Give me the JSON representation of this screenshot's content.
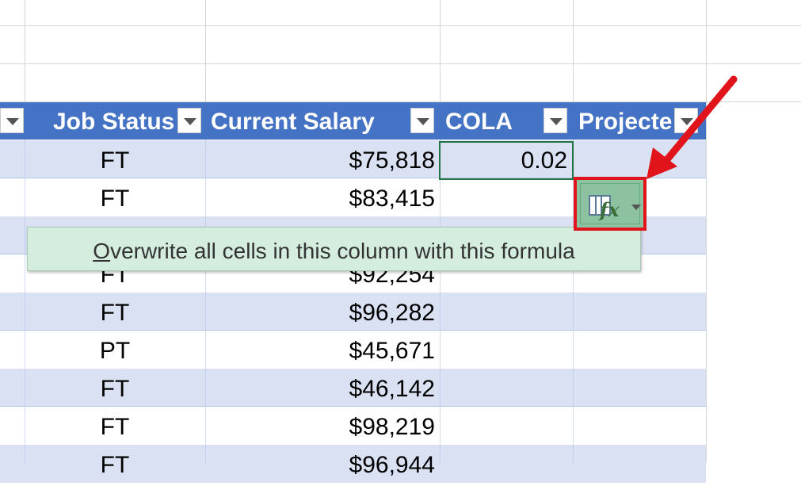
{
  "columns": {
    "job_status": "Job Status",
    "current_salary": "Current Salary",
    "cola": "COLA",
    "projected": "Projecte"
  },
  "rows": [
    {
      "status": "FT",
      "salary": "$75,818",
      "cola": "0.02"
    },
    {
      "status": "FT",
      "salary": "$83,415",
      "cola": ""
    },
    {
      "status": "",
      "salary": "",
      "cola": ""
    },
    {
      "status": "FT",
      "salary": "$92,254",
      "cola": ""
    },
    {
      "status": "FT",
      "salary": "$96,282",
      "cola": ""
    },
    {
      "status": "PT",
      "salary": "$45,671",
      "cola": ""
    },
    {
      "status": "FT",
      "salary": "$46,142",
      "cola": ""
    },
    {
      "status": "FT",
      "salary": "$98,219",
      "cola": ""
    },
    {
      "status": "FT",
      "salary": "$96,944",
      "cola": ""
    }
  ],
  "tooltip": {
    "accel": "O",
    "rest": "verwrite all cells in this column with this formula"
  },
  "smart_tag": {
    "icon": "autocorrect-options-icon"
  },
  "colors": {
    "header_bg": "#4472c4",
    "band_bg": "#d9e1f2",
    "tooltip_bg": "#d4eddf",
    "annotation_red": "#e1141c",
    "selection_green": "#217346"
  }
}
